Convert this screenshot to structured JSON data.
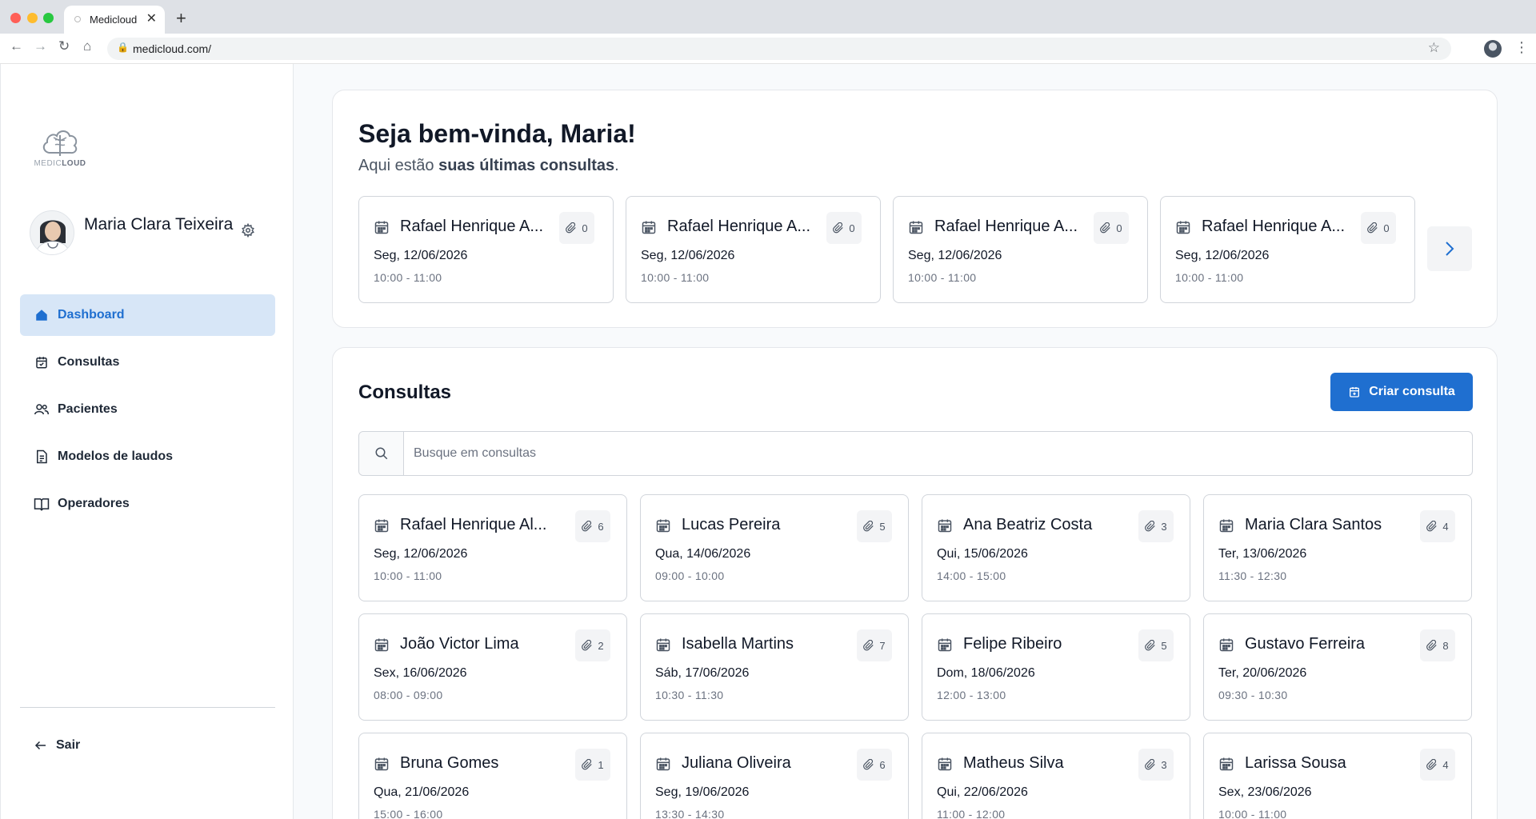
{
  "browser": {
    "tab_title": "Medicloud",
    "tab_close": "✕",
    "new_tab": "+",
    "url": "medicloud.com/"
  },
  "sidebar": {
    "logo_text_light": "MEDIC",
    "logo_text_bold": "LOUD",
    "user_name": "Maria Clara Teixeira",
    "menu": [
      {
        "label": "Dashboard",
        "icon": "home-icon",
        "active": true
      },
      {
        "label": "Consultas",
        "icon": "calendar-check-icon",
        "active": false
      },
      {
        "label": "Pacientes",
        "icon": "users-icon",
        "active": false
      },
      {
        "label": "Modelos de laudos",
        "icon": "document-icon",
        "active": false
      },
      {
        "label": "Operadores",
        "icon": "book-icon",
        "active": false
      }
    ],
    "logout_label": "Sair"
  },
  "welcome": {
    "title": "Seja bem-vinda, Maria!",
    "subtitle_prefix": "Aqui estão ",
    "subtitle_bold": "suas últimas consultas",
    "subtitle_suffix": ".",
    "recent": [
      {
        "name": "Rafael Henrique A...",
        "date": "Seg, 12/06/2026",
        "time": "10:00 - 11:00",
        "attachments": "0"
      },
      {
        "name": "Rafael Henrique A...",
        "date": "Seg, 12/06/2026",
        "time": "10:00 - 11:00",
        "attachments": "0"
      },
      {
        "name": "Rafael Henrique A...",
        "date": "Seg, 12/06/2026",
        "time": "10:00 - 11:00",
        "attachments": "0"
      },
      {
        "name": "Rafael Henrique A...",
        "date": "Seg, 12/06/2026",
        "time": "10:00 - 11:00",
        "attachments": "0"
      }
    ]
  },
  "consultas": {
    "title": "Consultas",
    "create_label": "Criar consulta",
    "search_placeholder": "Busque em consultas",
    "items": [
      {
        "name": "Rafael Henrique Al...",
        "date": "Seg, 12/06/2026",
        "time": "10:00 - 11:00",
        "attachments": "6"
      },
      {
        "name": "Lucas Pereira",
        "date": "Qua, 14/06/2026",
        "time": "09:00 - 10:00",
        "attachments": "5"
      },
      {
        "name": "Ana Beatriz Costa",
        "date": "Qui, 15/06/2026",
        "time": "14:00 - 15:00",
        "attachments": "3"
      },
      {
        "name": "Maria Clara Santos",
        "date": "Ter, 13/06/2026",
        "time": "11:30 - 12:30",
        "attachments": "4"
      },
      {
        "name": "João Victor Lima",
        "date": "Sex, 16/06/2026",
        "time": "08:00 - 09:00",
        "attachments": "2"
      },
      {
        "name": "Isabella Martins",
        "date": "Sáb, 17/06/2026",
        "time": "10:30 - 11:30",
        "attachments": "7"
      },
      {
        "name": "Felipe Ribeiro",
        "date": "Dom, 18/06/2026",
        "time": "12:00 - 13:00",
        "attachments": "5"
      },
      {
        "name": "Gustavo Ferreira",
        "date": "Ter, 20/06/2026",
        "time": "09:30 - 10:30",
        "attachments": "8"
      },
      {
        "name": "Bruna Gomes",
        "date": "Qua, 21/06/2026",
        "time": "15:00 - 16:00",
        "attachments": "1"
      },
      {
        "name": "Juliana Oliveira",
        "date": "Seg, 19/06/2026",
        "time": "13:30 - 14:30",
        "attachments": "6"
      },
      {
        "name": "Matheus Silva",
        "date": "Qui, 22/06/2026",
        "time": "11:00 - 12:00",
        "attachments": "3"
      },
      {
        "name": "Larissa Sousa",
        "date": "Sex, 23/06/2026",
        "time": "10:00 - 11:00",
        "attachments": "4"
      }
    ]
  },
  "colors": {
    "accent": "#1f6fd0",
    "active_bg": "#d7e6f7"
  }
}
